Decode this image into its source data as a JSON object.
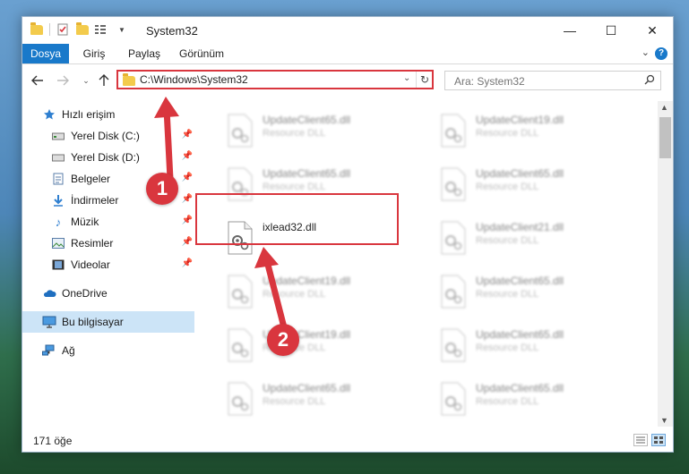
{
  "window": {
    "title": "System32",
    "controls": {
      "minimize": "—",
      "maximize": "☐",
      "close": "✕"
    }
  },
  "ribbon": {
    "tabs": [
      {
        "label": "Dosya",
        "active": true
      },
      {
        "label": "Giriş",
        "active": false
      },
      {
        "label": "Paylaş",
        "active": false
      },
      {
        "label": "Görünüm",
        "active": false
      }
    ],
    "help": "?"
  },
  "address_bar": {
    "path": "C:\\Windows\\System32"
  },
  "search": {
    "placeholder": "Ara: System32"
  },
  "sidebar": {
    "items": [
      {
        "label": "Hızlı erişim",
        "icon": "star-icon",
        "pinned": false
      },
      {
        "label": "Yerel Disk (C:)",
        "icon": "drive-icon",
        "pinned": true
      },
      {
        "label": "Yerel Disk (D:)",
        "icon": "drive-icon",
        "pinned": true
      },
      {
        "label": "Belgeler",
        "icon": "documents-icon",
        "pinned": true
      },
      {
        "label": "İndirmeler",
        "icon": "download-icon",
        "pinned": true
      },
      {
        "label": "Müzik",
        "icon": "music-icon",
        "pinned": true
      },
      {
        "label": "Resimler",
        "icon": "pictures-icon",
        "pinned": true
      },
      {
        "label": "Videolar",
        "icon": "video-icon",
        "pinned": true
      },
      {
        "label": "OneDrive",
        "icon": "cloud-icon",
        "pinned": false
      },
      {
        "label": "Bu bilgisayar",
        "icon": "computer-icon",
        "pinned": false,
        "selected": true
      },
      {
        "label": "Ağ",
        "icon": "network-icon",
        "pinned": false
      }
    ]
  },
  "files": {
    "left": [
      {
        "name": "UpdateClient65.dll",
        "type": "Resource DLL"
      },
      {
        "name": "UpdateClient65.dll",
        "type": "Resource DLL"
      },
      {
        "name": "ixlead32.dll",
        "type": "",
        "highlighted": true
      },
      {
        "name": "UpdateClient19.dll",
        "type": "Resource DLL"
      },
      {
        "name": "UpdateClient19.dll",
        "type": "Resource DLL"
      },
      {
        "name": "UpdateClient65.dll",
        "type": "Resource DLL"
      }
    ],
    "right": [
      {
        "name": "UpdateClient19.dll",
        "type": "Resource DLL"
      },
      {
        "name": "UpdateClient65.dll",
        "type": "Resource DLL"
      },
      {
        "name": "UpdateClient21.dll",
        "type": "Resource DLL"
      },
      {
        "name": "UpdateClient65.dll",
        "type": "Resource DLL"
      },
      {
        "name": "UpdateClient65.dll",
        "type": "Resource DLL"
      },
      {
        "name": "UpdateClient65.dll",
        "type": "Resource DLL"
      }
    ]
  },
  "status": {
    "item_count": "171 öğe"
  },
  "annotations": [
    {
      "number": "1"
    },
    {
      "number": "2"
    }
  ],
  "colors": {
    "accent": "#1979ca",
    "highlight": "#d9363e",
    "selected_bg": "#cce4f7"
  }
}
